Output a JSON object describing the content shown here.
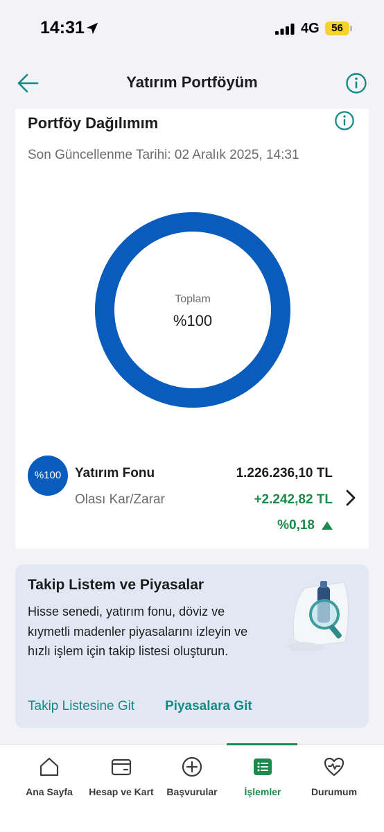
{
  "status_bar": {
    "time": "14:31",
    "network": "4G",
    "battery": "56",
    "icons": [
      "location-arrow-icon",
      "signal-icon",
      "battery-icon"
    ]
  },
  "nav": {
    "title": "Yatırım Portföyüm",
    "icons": [
      "back-arrow-icon",
      "info-icon"
    ]
  },
  "portfolio": {
    "title": "Portföy Dağılımım",
    "last_updated": "Son Güncellenme Tarihi: 02 Aralık 2025, 14:31",
    "donut_label": "Toplam",
    "donut_value": "%100",
    "donut_share": 1.0,
    "donut_color": "#0a5cbc",
    "fund": {
      "badge": "%100",
      "name": "Yatırım Fonu",
      "amount": "1.226.236,10 TL",
      "pl_label": "Olası Kar/Zarar",
      "pl_value": "+2.242,82 TL",
      "pl_pct": "%0,18",
      "trend": "up"
    }
  },
  "promo": {
    "title": "Takip Listem ve Piyasalar",
    "body": "Hisse senedi, yatırım fonu, döviz ve kıymetli madenler piyasalarını izleyin ve hızlı işlem için takip listesi oluşturun.",
    "link_watchlist": "Takip Listesine Git",
    "link_markets": "Piyasalara Git"
  },
  "tabbar": {
    "items": [
      {
        "label": "Ana Sayfa",
        "icon": "home-icon"
      },
      {
        "label": "Hesap ve Kart",
        "icon": "wallet-icon"
      },
      {
        "label": "Başvurular",
        "icon": "plus-circle-icon"
      },
      {
        "label": "İşlemler",
        "icon": "list-icon"
      },
      {
        "label": "Durumum",
        "icon": "heart-pulse-icon"
      }
    ],
    "active": "İşlemler"
  },
  "colors": {
    "accent_teal": "#138a86",
    "positive_green": "#1b8a4a",
    "brand_blue": "#0a5cbc"
  }
}
